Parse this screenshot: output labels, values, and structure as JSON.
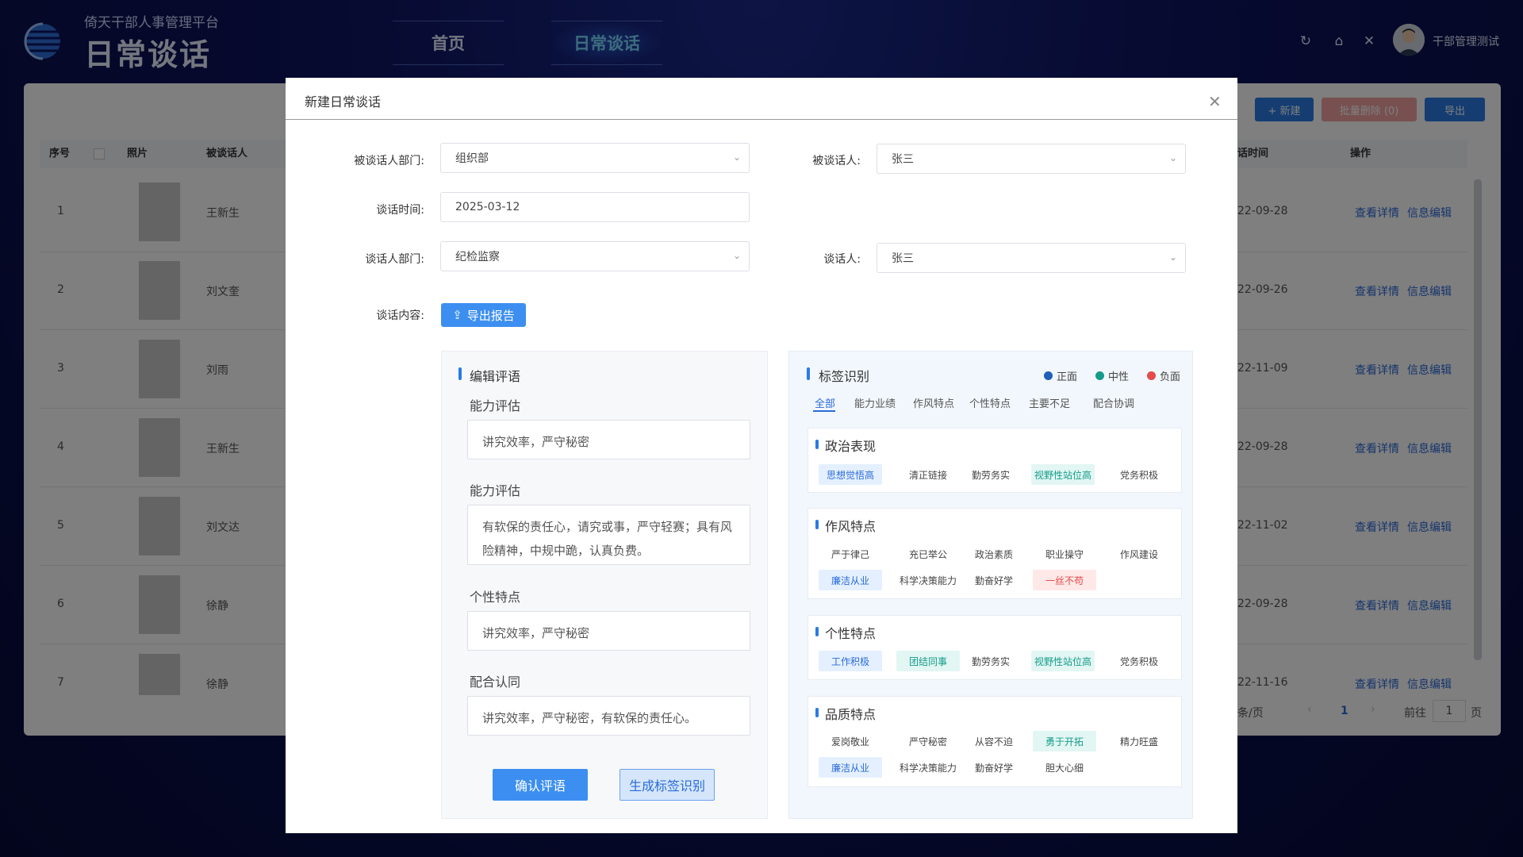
{
  "header": {
    "subtitle": "倚天干部人事管理平台",
    "title": "日常谈话",
    "nav": [
      {
        "label": "首页"
      },
      {
        "label": "日常谈话"
      }
    ],
    "user": "干部管理测试"
  },
  "toolbar": {
    "new": "+ 新建",
    "batch_delete": "批量删除 (0)",
    "export": "导出"
  },
  "table": {
    "headers": {
      "index": "序号",
      "photo": "照片",
      "interviewee": "被谈话人",
      "time": "话时间",
      "actions": "操作"
    },
    "rows": [
      {
        "index": "1",
        "name": "王新生",
        "date": "22-09-28"
      },
      {
        "index": "2",
        "name": "刘文奎",
        "date": "22-09-26"
      },
      {
        "index": "3",
        "name": "刘雨",
        "date": "22-11-09"
      },
      {
        "index": "4",
        "name": "王新生",
        "date": "22-09-28"
      },
      {
        "index": "5",
        "name": "刘文达",
        "date": "22-11-02"
      },
      {
        "index": "6",
        "name": "徐静",
        "date": "22-09-28"
      },
      {
        "index": "7",
        "name": "徐静",
        "date": "22-11-16"
      }
    ],
    "action_view": "查看详情",
    "action_edit": "信息编辑",
    "pager": {
      "per_page": "条/页",
      "current": "1",
      "goto": "前往",
      "goto_value": "1",
      "page_unit": "页"
    }
  },
  "modal": {
    "title": "新建日常谈话",
    "form": {
      "dept_label": "被谈话人部门:",
      "dept_value": "组织部",
      "person_label": "被谈话人:",
      "person_value": "张三",
      "time_label": "谈话时间:",
      "time_value": "2025-03-12",
      "talker_dept_label": "谈话人部门:",
      "talker_dept_value": "纪检监察",
      "talker_label": "谈话人:",
      "talker_value": "张三",
      "content_label": "谈话内容:",
      "export_btn": "导出报告"
    },
    "edit": {
      "title": "编辑评语",
      "sections": [
        {
          "label": "能力评估",
          "text": "讲究效率，严守秘密"
        },
        {
          "label": "能力评估",
          "text": "有软保的责任心，请究或事，严守轻赛；具有风险精神，中规中跪，认真负费。"
        },
        {
          "label": "个性特点",
          "text": "讲究效率，严守秘密"
        },
        {
          "label": "配合认同",
          "text": "讲究效率，严守秘密，有软保的责任心。"
        }
      ],
      "confirm_btn": "确认评语",
      "generate_btn": "生成标签识别"
    },
    "tags": {
      "title": "标签识别",
      "legend": [
        {
          "label": "正面",
          "color": "#1f5fb8"
        },
        {
          "label": "中性",
          "color": "#139c8a"
        },
        {
          "label": "负面",
          "color": "#e44b4b"
        }
      ],
      "tabs": [
        "全部",
        "能力业绩",
        "作风特点",
        "个性特点",
        "主要不足",
        "配合协调"
      ],
      "cards": [
        {
          "title": "政治表现",
          "rows": [
            [
              {
                "t": "思想觉悟高",
                "k": "pos"
              },
              {
                "t": "清正链接",
                "k": ""
              },
              {
                "t": "勤劳务实",
                "k": ""
              },
              {
                "t": "视野性站位高",
                "k": "neu"
              },
              {
                "t": "党务积极",
                "k": ""
              }
            ]
          ]
        },
        {
          "title": "作风特点",
          "rows": [
            [
              {
                "t": "严于律己",
                "k": ""
              },
              {
                "t": "充已举公",
                "k": ""
              },
              {
                "t": "政治素质",
                "k": ""
              },
              {
                "t": "职业操守",
                "k": ""
              },
              {
                "t": "作风建设",
                "k": ""
              }
            ],
            [
              {
                "t": "廉洁从业",
                "k": "pos"
              },
              {
                "t": "科学决策能力",
                "k": ""
              },
              {
                "t": "勤奋好学",
                "k": ""
              },
              {
                "t": "一丝不苟",
                "k": "neg"
              }
            ]
          ]
        },
        {
          "title": "个性特点",
          "rows": [
            [
              {
                "t": "工作积极",
                "k": "pos"
              },
              {
                "t": "团结同事",
                "k": "neu"
              },
              {
                "t": "勤劳务实",
                "k": ""
              },
              {
                "t": "视野性站位高",
                "k": "neu"
              },
              {
                "t": "党务积极",
                "k": ""
              }
            ]
          ]
        },
        {
          "title": "品质特点",
          "rows": [
            [
              {
                "t": "爱岗敬业",
                "k": ""
              },
              {
                "t": "严守秘密",
                "k": ""
              },
              {
                "t": "从容不迫",
                "k": ""
              },
              {
                "t": "勇于开拓",
                "k": "neu"
              },
              {
                "t": "精力旺盛",
                "k": ""
              }
            ],
            [
              {
                "t": "廉洁从业",
                "k": "pos"
              },
              {
                "t": "科学决策能力",
                "k": ""
              },
              {
                "t": "勤奋好学",
                "k": ""
              },
              {
                "t": "胆大心细",
                "k": ""
              }
            ]
          ]
        }
      ]
    }
  }
}
